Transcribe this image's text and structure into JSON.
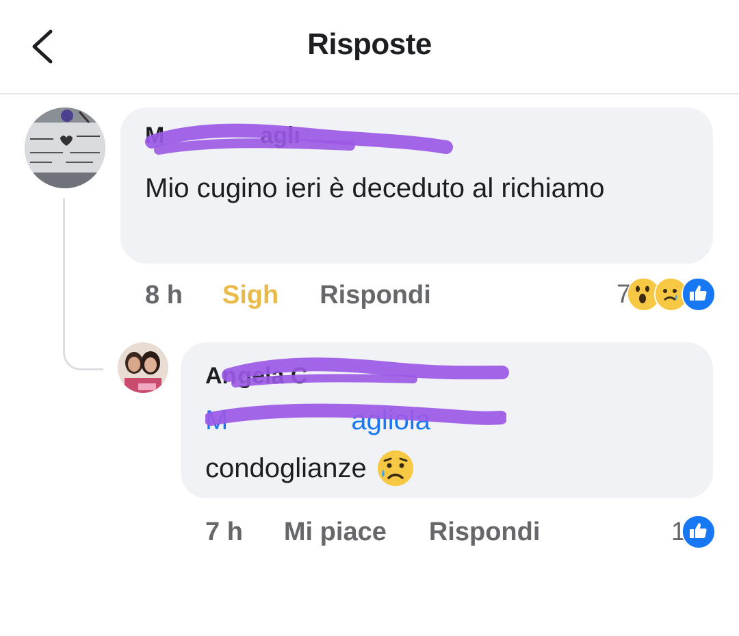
{
  "header": {
    "title": "Risposte",
    "back_icon": "chevron-left-icon"
  },
  "comment": {
    "author": "M",
    "author_suffix": "aglı",
    "text": "Mio cugino ieri è deceduto al richiamo",
    "time": "8 h",
    "reaction_label": "Sigh",
    "reply_label": "Rispondi",
    "reaction_count": "7",
    "reactions": [
      "wow-icon",
      "sad-icon",
      "like-icon"
    ],
    "reaction_color": "#e9b949",
    "avatar_icon": "plaque-avatar"
  },
  "reply": {
    "author": "An",
    "author_mid": "gela C",
    "mention": "M",
    "mention_suffix": "agliola",
    "text": "condoglianze",
    "text_emoji": "sad-tear-icon",
    "time": "7 h",
    "like_label": "Mi piace",
    "reply_label": "Rispondi",
    "reaction_count": "1",
    "reactions": [
      "like-icon"
    ],
    "avatar_icon": "photo-avatar"
  },
  "colors": {
    "bubble": "#f0f2f5",
    "meta_text": "#65676b",
    "mention": "#1877f2",
    "like_blue": "#1877f2",
    "redaction": "#9b59e6"
  }
}
